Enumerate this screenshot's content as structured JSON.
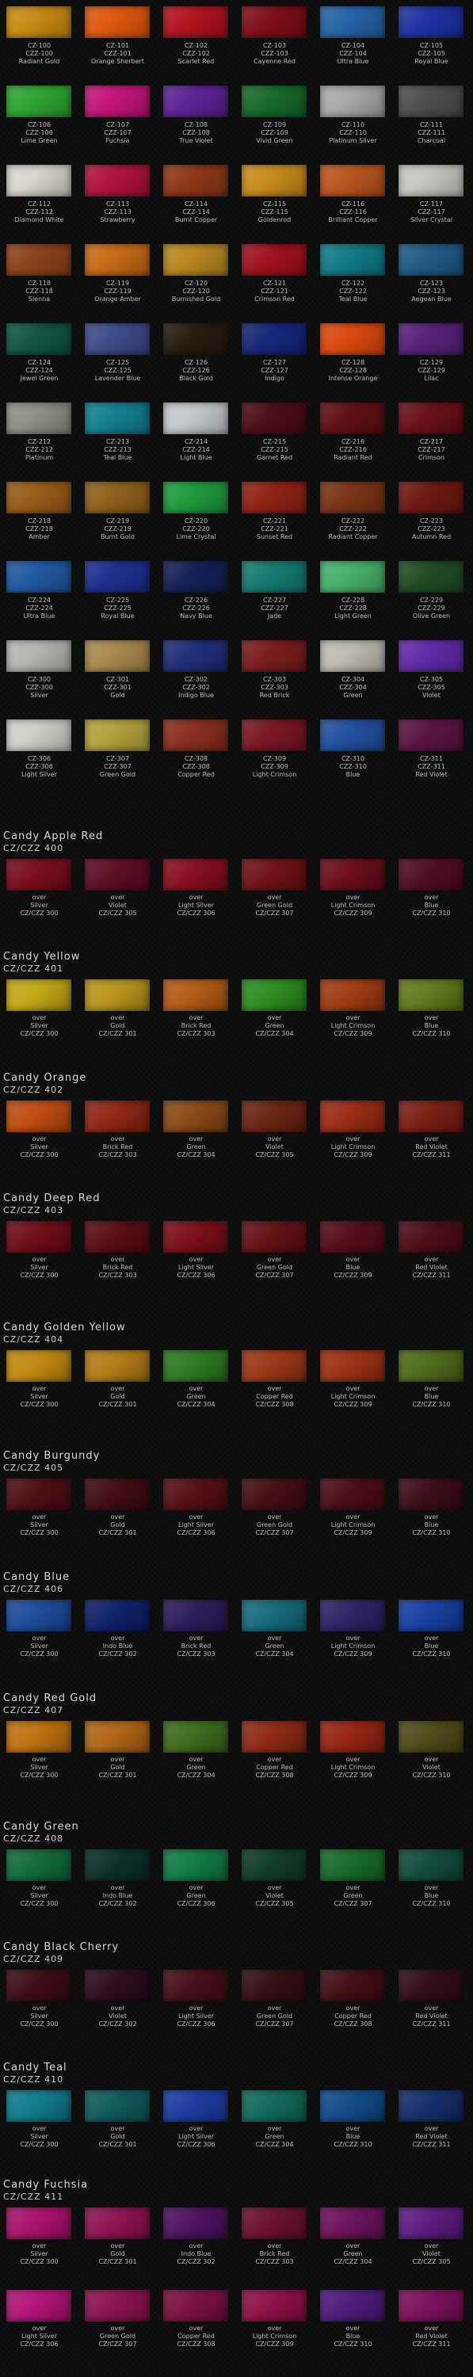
{
  "grid": [
    [
      {
        "code": "CZ-100",
        "code2": "CZZ-100",
        "name": "Radiant Gold",
        "color": "#c98a10"
      },
      {
        "code": "CZ-101",
        "code2": "CZZ-101",
        "name": "Orange Sherbert",
        "color": "#e0560c"
      },
      {
        "code": "CZ-102",
        "code2": "CZZ-102",
        "name": "Scarlet Red",
        "color": "#b0101f"
      },
      {
        "code": "CZ-103",
        "code2": "CZZ-103",
        "name": "Cayenne Red",
        "color": "#7e0b16"
      },
      {
        "code": "CZ-104",
        "code2": "CZZ-104",
        "name": "Ultra Blue",
        "color": "#2263a8"
      },
      {
        "code": "CZ-105",
        "code2": "CZZ-105",
        "name": "Royal Blue",
        "color": "#1d2fa2"
      }
    ],
    [
      {
        "code": "CZ-106",
        "code2": "CZZ-106",
        "name": "Lime Green",
        "color": "#2da52f"
      },
      {
        "code": "CZ-107",
        "code2": "CZZ-107",
        "name": "Fuchsia",
        "color": "#c21378"
      },
      {
        "code": "CZ-108",
        "code2": "CZZ-108",
        "name": "True Violet",
        "color": "#5a2296"
      },
      {
        "code": "CZ-109",
        "code2": "CZZ-109",
        "name": "Vivid Green",
        "color": "#14692a"
      },
      {
        "code": "CZ-110",
        "code2": "CZZ-110",
        "name": "Platinum Silver",
        "color": "#a9a9a9"
      },
      {
        "code": "CZ-111",
        "code2": "CZZ-111",
        "name": "Charcoal",
        "color": "#4c4c4c"
      }
    ],
    [
      {
        "code": "CZ-112",
        "code2": "CZZ-112",
        "name": "Diamond White",
        "color": "#d8d5cd"
      },
      {
        "code": "CZ-113",
        "code2": "CZZ-113",
        "name": "Strawberry",
        "color": "#b0103d"
      },
      {
        "code": "CZ-114",
        "code2": "CZZ-114",
        "name": "Burnt Copper",
        "color": "#8e3613"
      },
      {
        "code": "CZ-115",
        "code2": "CZZ-115",
        "name": "Goldenrod",
        "color": "#c98a1a"
      },
      {
        "code": "CZ-116",
        "code2": "CZZ-116",
        "name": "Brilliant Copper",
        "color": "#b9541c"
      },
      {
        "code": "CZ-117",
        "code2": "CZZ-117",
        "name": "Silver Crystal",
        "color": "#c7c7c2"
      }
    ],
    [
      {
        "code": "CZ-118",
        "code2": "CZZ-118",
        "name": "Sienna",
        "color": "#8d3f16"
      },
      {
        "code": "CZ-119",
        "code2": "CZZ-119",
        "name": "Orange Amber",
        "color": "#c66a12"
      },
      {
        "code": "CZ-120",
        "code2": "CZZ-120",
        "name": "Burnished Gold",
        "color": "#b8861e"
      },
      {
        "code": "CZ-121",
        "code2": "CZZ-121",
        "name": "Crimson Red",
        "color": "#9e0f1c"
      },
      {
        "code": "CZ-122",
        "code2": "CZZ-122",
        "name": "Teal Blue",
        "color": "#0e7a86"
      },
      {
        "code": "CZ-123",
        "code2": "CZZ-123",
        "name": "Aegean Blue",
        "color": "#1c5a86"
      }
    ],
    [
      {
        "code": "CZ-124",
        "code2": "CZZ-124",
        "name": "Jewel Green",
        "color": "#0d5544"
      },
      {
        "code": "CZ-125",
        "code2": "CZZ-125",
        "name": "Lavender Blue",
        "color": "#3b4a8a"
      },
      {
        "code": "CZ-126",
        "code2": "CZZ-126",
        "name": "Black Gold",
        "color": "#241a0e"
      },
      {
        "code": "CZ-127",
        "code2": "CZZ-127",
        "name": "Indigo",
        "color": "#14247a"
      },
      {
        "code": "CZ-128",
        "code2": "CZZ-128",
        "name": "Intense Orange",
        "color": "#d9480c"
      },
      {
        "code": "CZ-129",
        "code2": "CZZ-129",
        "name": "Lilac",
        "color": "#56207a"
      }
    ],
    [
      {
        "code": "CZ-212",
        "code2": "CZZ-212",
        "name": "Platinum",
        "color": "#8f8f86"
      },
      {
        "code": "CZ-213",
        "code2": "CZZ-213",
        "name": "Teal Blue",
        "color": "#0f7f8f"
      },
      {
        "code": "CZ-214",
        "code2": "CZZ-214",
        "name": "Light Blue",
        "color": "#c5c8cc"
      },
      {
        "code": "CZ-215",
        "code2": "CZZ-215",
        "name": "Garnet Red",
        "color": "#4a0a14"
      },
      {
        "code": "CZ-216",
        "code2": "CZZ-216",
        "name": "Radiant Red",
        "color": "#5e0d10"
      },
      {
        "code": "CZ-217",
        "code2": "CZZ-217",
        "name": "Crimson",
        "color": "#6a0c18"
      }
    ],
    [
      {
        "code": "CZ-218",
        "code2": "CZZ-218",
        "name": "Amber",
        "color": "#9a5a16"
      },
      {
        "code": "CZ-219",
        "code2": "CZZ-219",
        "name": "Burnt Gold",
        "color": "#8f5f18"
      },
      {
        "code": "CZ-220",
        "code2": "CZZ-220",
        "name": "Lime Crystal",
        "color": "#1d9a3c"
      },
      {
        "code": "CZ-221",
        "code2": "CZZ-221",
        "name": "Sunset Red",
        "color": "#8f2012"
      },
      {
        "code": "CZ-222",
        "code2": "CZZ-222",
        "name": "Radiant Copper",
        "color": "#7a3214"
      },
      {
        "code": "CZ-223",
        "code2": "CZZ-223",
        "name": "Autumn Red",
        "color": "#6d1611"
      }
    ],
    [
      {
        "code": "CZ-224",
        "code2": "CZZ-224",
        "name": "Ultra Blue",
        "color": "#1e58a2"
      },
      {
        "code": "CZ-225",
        "code2": "CZZ-225",
        "name": "Royal Blue",
        "color": "#1d2c8f"
      },
      {
        "code": "CZ-226",
        "code2": "CZZ-226",
        "name": "Navy Blue",
        "color": "#111f55"
      },
      {
        "code": "CZ-227",
        "code2": "CZZ-227",
        "name": "Jade",
        "color": "#137a70"
      },
      {
        "code": "CZ-228",
        "code2": "CZZ-228",
        "name": "Light Green",
        "color": "#46b06c"
      },
      {
        "code": "CZ-229",
        "code2": "CZZ-229",
        "name": "Olive Green",
        "color": "#1f4a22"
      }
    ],
    [
      {
        "code": "CZ-300",
        "code2": "CZZ-300",
        "name": "Silver",
        "color": "#b5b5b1"
      },
      {
        "code": "CZ-301",
        "code2": "CZZ-301",
        "name": "Gold",
        "color": "#a88a4a"
      },
      {
        "code": "CZ-302",
        "code2": "CZZ-302",
        "name": "Indigo Blue",
        "color": "#1e2c7a"
      },
      {
        "code": "CZ-303",
        "code2": "CZZ-303",
        "name": "Red Brick",
        "color": "#7a1a1c"
      },
      {
        "code": "CZ-304",
        "code2": "CZZ-304",
        "name": "Green",
        "color": "#bdbbb2"
      },
      {
        "code": "CZ-305",
        "code2": "CZZ-305",
        "name": "Violet",
        "color": "#5e2aa6"
      }
    ],
    [
      {
        "code": "CZ-306",
        "code2": "CZZ-306",
        "name": "Light Silver",
        "color": "#cfcfcb"
      },
      {
        "code": "CZ-307",
        "code2": "CZZ-307",
        "name": "Green Gold",
        "color": "#b2a23a"
      },
      {
        "code": "CZ-308",
        "code2": "CZZ-308",
        "name": "Copper Red",
        "color": "#8a2c1c"
      },
      {
        "code": "CZ-309",
        "code2": "CZZ-309",
        "name": "Light Crimson",
        "color": "#7a1424"
      },
      {
        "code": "CZ-310",
        "code2": "CZZ-310",
        "name": "Blue",
        "color": "#1f4fa0"
      },
      {
        "code": "CZ-311",
        "code2": "CZZ-311",
        "name": "Red Violet",
        "color": "#5a1240"
      }
    ]
  ],
  "candy_sections": [
    {
      "title": "Candy Apple Red",
      "code": "CZ/CZZ 400",
      "items": [
        {
          "over": "over",
          "base": "Silver",
          "code": "CZ/CZZ 300",
          "color": "#7a0a1a"
        },
        {
          "over": "over",
          "base": "Violet",
          "code": "CZ/CZZ 305",
          "color": "#5c0a22"
        },
        {
          "over": "over",
          "base": "Light Silver",
          "code": "CZ/CZZ 306",
          "color": "#860c1e"
        },
        {
          "over": "over",
          "base": "Green Gold",
          "code": "CZ/CZZ 307",
          "color": "#6e0f14"
        },
        {
          "over": "over",
          "base": "Light Crimson",
          "code": "CZ/CZZ 309",
          "color": "#6a0a1a"
        },
        {
          "over": "over",
          "base": "Blue",
          "code": "CZ/CZZ 310",
          "color": "#4e0a22"
        }
      ]
    },
    {
      "title": "Candy Yellow",
      "code": "CZ/CZZ 401",
      "items": [
        {
          "over": "over",
          "base": "Silver",
          "code": "CZ/CZZ 300",
          "color": "#c2a814"
        },
        {
          "over": "over",
          "base": "Gold",
          "code": "CZ/CZZ 301",
          "color": "#b8941a"
        },
        {
          "over": "over",
          "base": "Brick Red",
          "code": "CZ/CZZ 303",
          "color": "#b25a14"
        },
        {
          "over": "over",
          "base": "Green",
          "code": "CZ/CZZ 304",
          "color": "#2b8c1e"
        },
        {
          "over": "over",
          "base": "Light Crimson",
          "code": "CZ/CZZ 309",
          "color": "#9e3a10"
        },
        {
          "over": "over",
          "base": "Blue",
          "code": "CZ/CZZ 310",
          "color": "#5f7a1a"
        }
      ]
    },
    {
      "title": "Candy Orange",
      "code": "CZ/CZZ 402",
      "items": [
        {
          "over": "over",
          "base": "Silver",
          "code": "CZ/CZZ 300",
          "color": "#c04a0e"
        },
        {
          "over": "over",
          "base": "Brick Red",
          "code": "CZ/CZZ 303",
          "color": "#8e2410"
        },
        {
          "over": "over",
          "base": "Green",
          "code": "CZ/CZZ 304",
          "color": "#8a4812"
        },
        {
          "over": "over",
          "base": "Violet",
          "code": "CZ/CZZ 305",
          "color": "#6a2210"
        },
        {
          "over": "over",
          "base": "Light Crimson",
          "code": "CZ/CZZ 309",
          "color": "#9a2a10"
        },
        {
          "over": "over",
          "base": "Red Violet",
          "code": "CZ/CZZ 311",
          "color": "#7a1c12"
        }
      ]
    },
    {
      "title": "Candy Deep Red",
      "code": "CZ/CZZ 403",
      "items": [
        {
          "over": "over",
          "base": "Silver",
          "code": "CZ/CZZ 300",
          "color": "#6e0a14"
        },
        {
          "over": "over",
          "base": "Brick Red",
          "code": "CZ/CZZ 303",
          "color": "#5a0a12"
        },
        {
          "over": "over",
          "base": "Light Silver",
          "code": "CZ/CZZ 306",
          "color": "#7a0c16"
        },
        {
          "over": "over",
          "base": "Green Gold",
          "code": "CZ/CZZ 307",
          "color": "#620e12"
        },
        {
          "over": "over",
          "base": "Blue",
          "code": "CZ/CZZ 309",
          "color": "#540a16"
        },
        {
          "over": "over",
          "base": "Red Violet",
          "code": "CZ/CZZ 311",
          "color": "#4c0a14"
        }
      ]
    },
    {
      "title": "Candy Golden Yellow",
      "code": "CZ/CZZ 404",
      "items": [
        {
          "over": "over",
          "base": "Silver",
          "code": "CZ/CZZ 300",
          "color": "#c2880e"
        },
        {
          "over": "over",
          "base": "Gold",
          "code": "CZ/CZZ 301",
          "color": "#b27a14"
        },
        {
          "over": "over",
          "base": "Green",
          "code": "CZ/CZZ 304",
          "color": "#2a7a1e"
        },
        {
          "over": "over",
          "base": "Copper Red",
          "code": "CZ/CZZ 308",
          "color": "#9a3612"
        },
        {
          "over": "over",
          "base": "Light Crimson",
          "code": "CZ/CZZ 309",
          "color": "#9a3010"
        },
        {
          "over": "over",
          "base": "Blue",
          "code": "CZ/CZZ 310",
          "color": "#4e6a16"
        }
      ]
    },
    {
      "title": "Candy Burgundy",
      "code": "CZ/CZZ 405",
      "items": [
        {
          "over": "over",
          "base": "Silver",
          "code": "CZ/CZZ 300",
          "color": "#4e0a12"
        },
        {
          "over": "over",
          "base": "Gold",
          "code": "CZ/CZZ 301",
          "color": "#3e0a10"
        },
        {
          "over": "over",
          "base": "Light Silver",
          "code": "CZ/CZZ 306",
          "color": "#560c14"
        },
        {
          "over": "over",
          "base": "Green Gold",
          "code": "CZ/CZZ 307",
          "color": "#420c10"
        },
        {
          "over": "over",
          "base": "Light Crimson",
          "code": "CZ/CZZ 309",
          "color": "#4a0a14"
        },
        {
          "over": "over",
          "base": "Blue",
          "code": "CZ/CZZ 310",
          "color": "#380a16"
        }
      ]
    },
    {
      "title": "Candy Blue",
      "code": "CZ/CZZ 406",
      "items": [
        {
          "over": "over",
          "base": "Silver",
          "code": "CZ/CZZ 300",
          "color": "#1a4a9a"
        },
        {
          "over": "over",
          "base": "Indo Blue",
          "code": "CZ/CZZ 302",
          "color": "#0e1e6a"
        },
        {
          "over": "over",
          "base": "Brick Red",
          "code": "CZ/CZZ 303",
          "color": "#2a1a5a"
        },
        {
          "over": "over",
          "base": "Green",
          "code": "CZ/CZZ 304",
          "color": "#136a7a"
        },
        {
          "over": "over",
          "base": "Light Crimson",
          "code": "CZ/CZZ 309",
          "color": "#2a2266"
        },
        {
          "over": "over",
          "base": "Blue",
          "code": "CZ/CZZ 310",
          "color": "#143ea0"
        }
      ]
    },
    {
      "title": "Candy Red Gold",
      "code": "CZ/CZZ 407",
      "items": [
        {
          "over": "over",
          "base": "Silver",
          "code": "CZ/CZZ 300",
          "color": "#c0700e"
        },
        {
          "over": "over",
          "base": "Gold",
          "code": "CZ/CZZ 301",
          "color": "#b06414"
        },
        {
          "over": "over",
          "base": "Green",
          "code": "CZ/CZZ 304",
          "color": "#3e6a18"
        },
        {
          "over": "over",
          "base": "Copper Red",
          "code": "CZ/CZZ 308",
          "color": "#8e2812"
        },
        {
          "over": "over",
          "base": "Light Crimson",
          "code": "CZ/CZZ 309",
          "color": "#962210"
        },
        {
          "over": "over",
          "base": "Violet",
          "code": "CZ/CZZ 310",
          "color": "#4e4a16"
        }
      ]
    },
    {
      "title": "Candy Green",
      "code": "CZ/CZZ 408",
      "items": [
        {
          "over": "over",
          "base": "Silver",
          "code": "CZ/CZZ 300",
          "color": "#0e6a3a"
        },
        {
          "over": "over",
          "base": "Indo Blue",
          "code": "CZ/CZZ 302",
          "color": "#0a2e26"
        },
        {
          "over": "over",
          "base": "Green",
          "code": "CZ/CZZ 306",
          "color": "#0e7a44"
        },
        {
          "over": "over",
          "base": "Violet",
          "code": "CZ/CZZ 305",
          "color": "#0e3a26"
        },
        {
          "over": "over",
          "base": "Green",
          "code": "CZ/CZZ 307",
          "color": "#146a2a"
        },
        {
          "over": "over",
          "base": "Blue",
          "code": "CZ/CZZ 310",
          "color": "#0e4a3a"
        }
      ]
    },
    {
      "title": "Candy Black Cherry",
      "code": "CZ/CZZ 409",
      "items": [
        {
          "over": "over",
          "base": "Silver",
          "code": "CZ/CZZ 300",
          "color": "#3a0a14"
        },
        {
          "over": "over",
          "base": "Violet",
          "code": "CZ/CZZ 302",
          "color": "#2a0a1a"
        },
        {
          "over": "over",
          "base": "Light Silver",
          "code": "CZ/CZZ 306",
          "color": "#420c18"
        },
        {
          "over": "over",
          "base": "Green Gold",
          "code": "CZ/CZZ 307",
          "color": "#300c12"
        },
        {
          "over": "over",
          "base": "Copper Red",
          "code": "CZ/CZZ 308",
          "color": "#3e0c12"
        },
        {
          "over": "over",
          "base": "Red Violet",
          "code": "CZ/CZZ 311",
          "color": "#2e0a16"
        }
      ]
    },
    {
      "title": "Candy Teal",
      "code": "CZ/CZZ 410",
      "items": [
        {
          "over": "over",
          "base": "Silver",
          "code": "CZ/CZZ 300",
          "color": "#0e7a8a"
        },
        {
          "over": "over",
          "base": "Gold",
          "code": "CZ/CZZ 301",
          "color": "#0e5a5a"
        },
        {
          "over": "over",
          "base": "Light Silver",
          "code": "CZ/CZZ 306",
          "color": "#1a3aa0"
        },
        {
          "over": "over",
          "base": "Green",
          "code": "CZ/CZZ 304",
          "color": "#0e6a5a"
        },
        {
          "over": "over",
          "base": "Blue",
          "code": "CZ/CZZ 310",
          "color": "#0e4a8a"
        },
        {
          "over": "over",
          "base": "Red Violet",
          "code": "CZ/CZZ 311",
          "color": "#142a6a"
        }
      ]
    },
    {
      "title": "Candy Fuchsia",
      "code": "CZ/CZZ 411",
      "items": [
        {
          "over": "over",
          "base": "Silver",
          "code": "CZ/CZZ 300",
          "color": "#a8106a"
        },
        {
          "over": "over",
          "base": "Gold",
          "code": "CZ/CZZ 301",
          "color": "#8e1050"
        },
        {
          "over": "over",
          "base": "Indo Blue",
          "code": "CZ/CZZ 302",
          "color": "#4a1060"
        },
        {
          "over": "over",
          "base": "Brick Red",
          "code": "CZ/CZZ 303",
          "color": "#6a0e30"
        },
        {
          "over": "over",
          "base": "Green",
          "code": "CZ/CZZ 304",
          "color": "#6a1058"
        },
        {
          "over": "over",
          "base": "Violet",
          "code": "CZ/CZZ 305",
          "color": "#5a1a80"
        }
      ],
      "items2": [
        {
          "over": "over",
          "base": "Light Silver",
          "code": "CZ/CZZ 306",
          "color": "#b01275"
        },
        {
          "over": "over",
          "base": "Green Gold",
          "code": "CZ/CZZ 307",
          "color": "#8a104e"
        },
        {
          "over": "over",
          "base": "Copper Red",
          "code": "CZ/CZZ 308",
          "color": "#7a0e3e"
        },
        {
          "over": "over",
          "base": "Light Crimson",
          "code": "CZ/CZZ 309",
          "color": "#8c0e46"
        },
        {
          "over": "over",
          "base": "Blue",
          "code": "CZ/CZZ 310",
          "color": "#4a1a7a"
        },
        {
          "over": "over",
          "base": "Red Violet",
          "code": "CZ/CZZ 311",
          "color": "#7a0e5a"
        }
      ]
    }
  ]
}
